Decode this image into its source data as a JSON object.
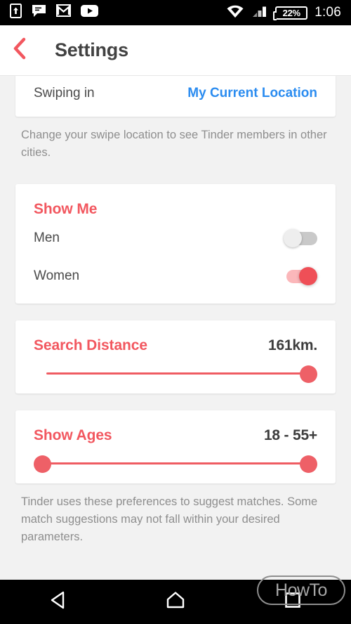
{
  "statusbar": {
    "icons": [
      "upload-icon",
      "messages-icon",
      "gmail-icon",
      "youtube-icon"
    ],
    "wifi_icon": "wifi-icon",
    "signal_icon": "cellular-signal-icon",
    "battery_percent": "22%",
    "time": "1:06"
  },
  "header": {
    "back_icon": "back-chevron-icon",
    "title": "Settings"
  },
  "swipe_card": {
    "label": "Swiping in",
    "value": "My Current Location",
    "note": "Change your swipe location to see Tinder members in other cities."
  },
  "show_me": {
    "title": "Show Me",
    "options": [
      {
        "label": "Men",
        "state": "off"
      },
      {
        "label": "Women",
        "state": "on"
      }
    ]
  },
  "search_distance": {
    "title": "Search Distance",
    "value": "161km.",
    "thumb_position_percent": 100
  },
  "show_ages": {
    "title": "Show Ages",
    "value": "18 - 55+",
    "min_thumb_percent": 0,
    "max_thumb_percent": 100,
    "footer_note": "Tinder uses these preferences to suggest matches. Some match suggestions may not fall within your desired parameters."
  },
  "navbar": {
    "back_icon": "nav-back-triangle-icon",
    "home_icon": "nav-home-icon",
    "recents_icon": "nav-recents-square-icon"
  },
  "watermark": {
    "text": "HowTo"
  },
  "colors": {
    "accent_red": "#f2575f",
    "link_blue": "#2b8cf0",
    "page_bg": "#f2f2f2",
    "card_bg": "#ffffff",
    "text_dark": "#4a4a4a",
    "text_muted": "#8e8e8e"
  }
}
